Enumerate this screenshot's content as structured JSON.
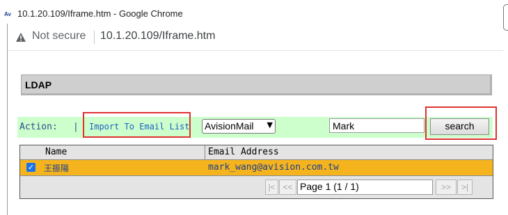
{
  "window": {
    "app_icon": "avision-icon",
    "title": "10.1.20.109/Iframe.htm - Google Chrome"
  },
  "addressbar": {
    "security_icon": "warning-triangle-icon",
    "security_text": "Not secure",
    "url": "10.1.20.109/Iframe.htm"
  },
  "panel": {
    "title": "LDAP"
  },
  "action_bar": {
    "label": "Action:",
    "separator": "|",
    "import_link": "Import To Email List",
    "address_book_selected": "AvisionMail",
    "search_value": "Mark",
    "search_button": "search"
  },
  "table": {
    "columns": [
      "Name",
      "Email Address"
    ],
    "rows": [
      {
        "checked": true,
        "name": "王振陽",
        "email": "mark_wang@avision.com.tw"
      }
    ]
  },
  "pager": {
    "first": "|<",
    "prev": "<<",
    "page_label": "Page 1 (1 / 1)",
    "next": ">>",
    "last": ">|"
  },
  "colors": {
    "action_bar_bg": "#ccffcc",
    "selected_row_bg": "#f5b41e",
    "highlight_border": "#e03030",
    "link": "#1c5cc4"
  }
}
